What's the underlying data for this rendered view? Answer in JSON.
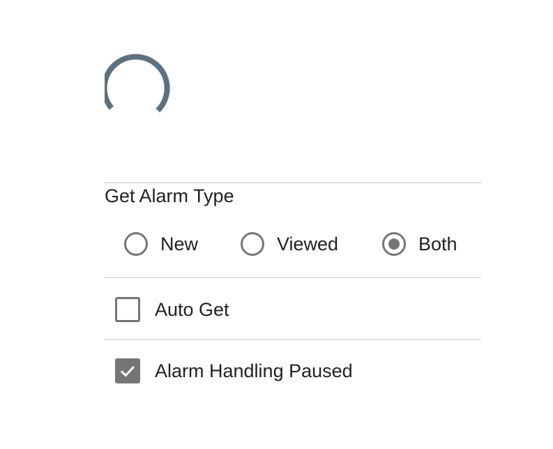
{
  "alarm_type": {
    "title": "Get Alarm Type",
    "options": [
      {
        "label": "New",
        "selected": false
      },
      {
        "label": "Viewed",
        "selected": false
      },
      {
        "label": "Both",
        "selected": true
      }
    ]
  },
  "auto_get": {
    "label": "Auto Get",
    "checked": false
  },
  "alarm_paused": {
    "label": "Alarm Handling Paused",
    "checked": true
  },
  "colors": {
    "spinner": "#5d7180",
    "control": "#757575",
    "divider": "#e0e0e0",
    "text": "#212121"
  },
  "icons": {
    "spinner": "loading-spinner-icon",
    "check": "check-icon"
  }
}
